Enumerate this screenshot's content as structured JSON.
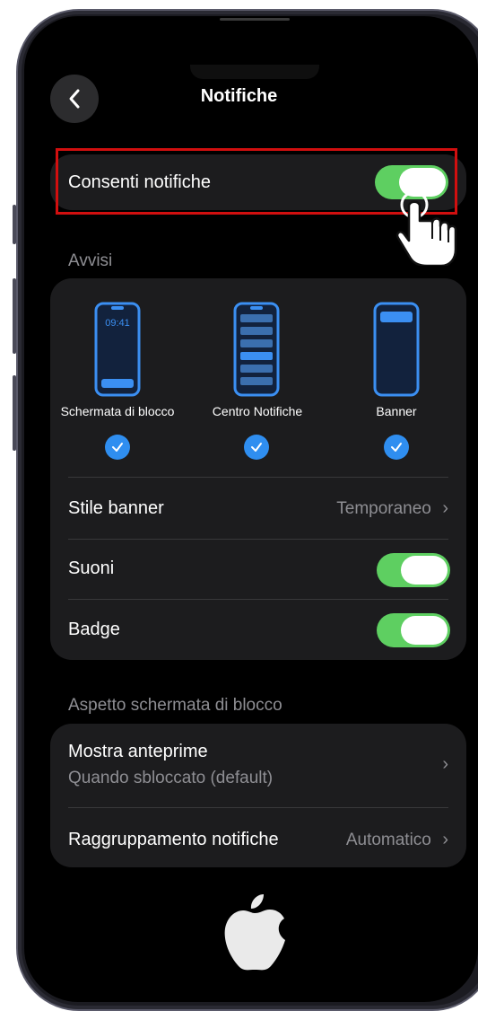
{
  "header": {
    "title": "Notifiche",
    "back_icon": "chevron-left-icon"
  },
  "allow": {
    "label": "Consenti notifiche",
    "enabled": true
  },
  "alerts": {
    "section_title": "Avvisi",
    "styles": [
      {
        "label": "Schermata di blocco",
        "time": "09:41",
        "checked": true
      },
      {
        "label": "Centro Notifiche",
        "checked": true
      },
      {
        "label": "Banner",
        "checked": true
      }
    ],
    "banner_style": {
      "label": "Stile banner",
      "value": "Temporaneo"
    },
    "sounds": {
      "label": "Suoni",
      "enabled": true
    },
    "badge": {
      "label": "Badge",
      "enabled": true
    }
  },
  "lock_screen": {
    "section_title": "Aspetto schermata di blocco",
    "show_previews": {
      "label": "Mostra anteprime",
      "value": "Quando sbloccato (default)"
    },
    "grouping": {
      "label": "Raggruppamento notifiche",
      "value": "Automatico"
    }
  },
  "colors": {
    "accent_green": "#5ecf61",
    "accent_blue": "#2f8ef0",
    "highlight_red": "#d10f0f"
  }
}
